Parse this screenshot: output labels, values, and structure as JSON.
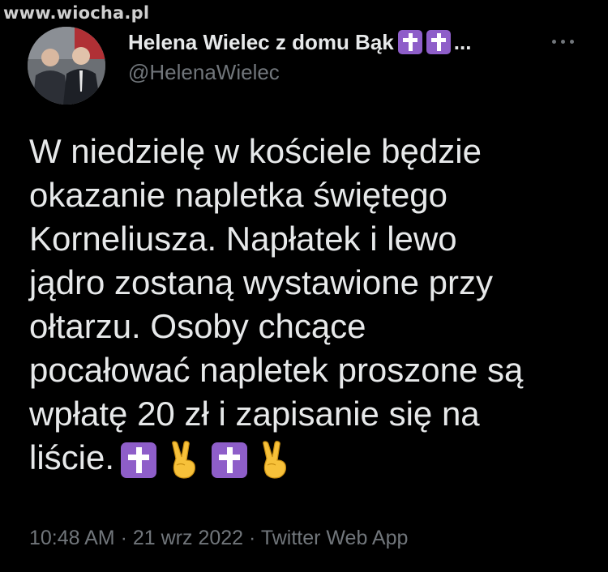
{
  "watermark": "www.wiocha.pl",
  "author": {
    "display_name": "Helena Wielec z domu Bąk",
    "name_suffix": "...",
    "handle": "@HelenaWielec"
  },
  "tweet": {
    "lines": [
      "W niedzielę w kościele będzie",
      "okazanie napletka świętego",
      "Korneliusza. Napłatek i lewo",
      "jądro zostaną wystawione przy",
      "ołtarzu. Osoby chcące",
      "pocałować napletek proszone są",
      "wpłatę 20 zł i zapisanie się na",
      "liście."
    ],
    "trailing_emoji": [
      "latin-cross-icon",
      "victory-hand-icon",
      "latin-cross-icon",
      "victory-hand-icon"
    ]
  },
  "meta": {
    "time": "10:48 AM",
    "separator": " · ",
    "date": "21 wrz 2022",
    "source": "Twitter Web App"
  },
  "colors": {
    "background": "#000000",
    "text": "#e7e9ea",
    "muted": "#71767b",
    "cross_emoji_bg": "#8e5ec9"
  }
}
